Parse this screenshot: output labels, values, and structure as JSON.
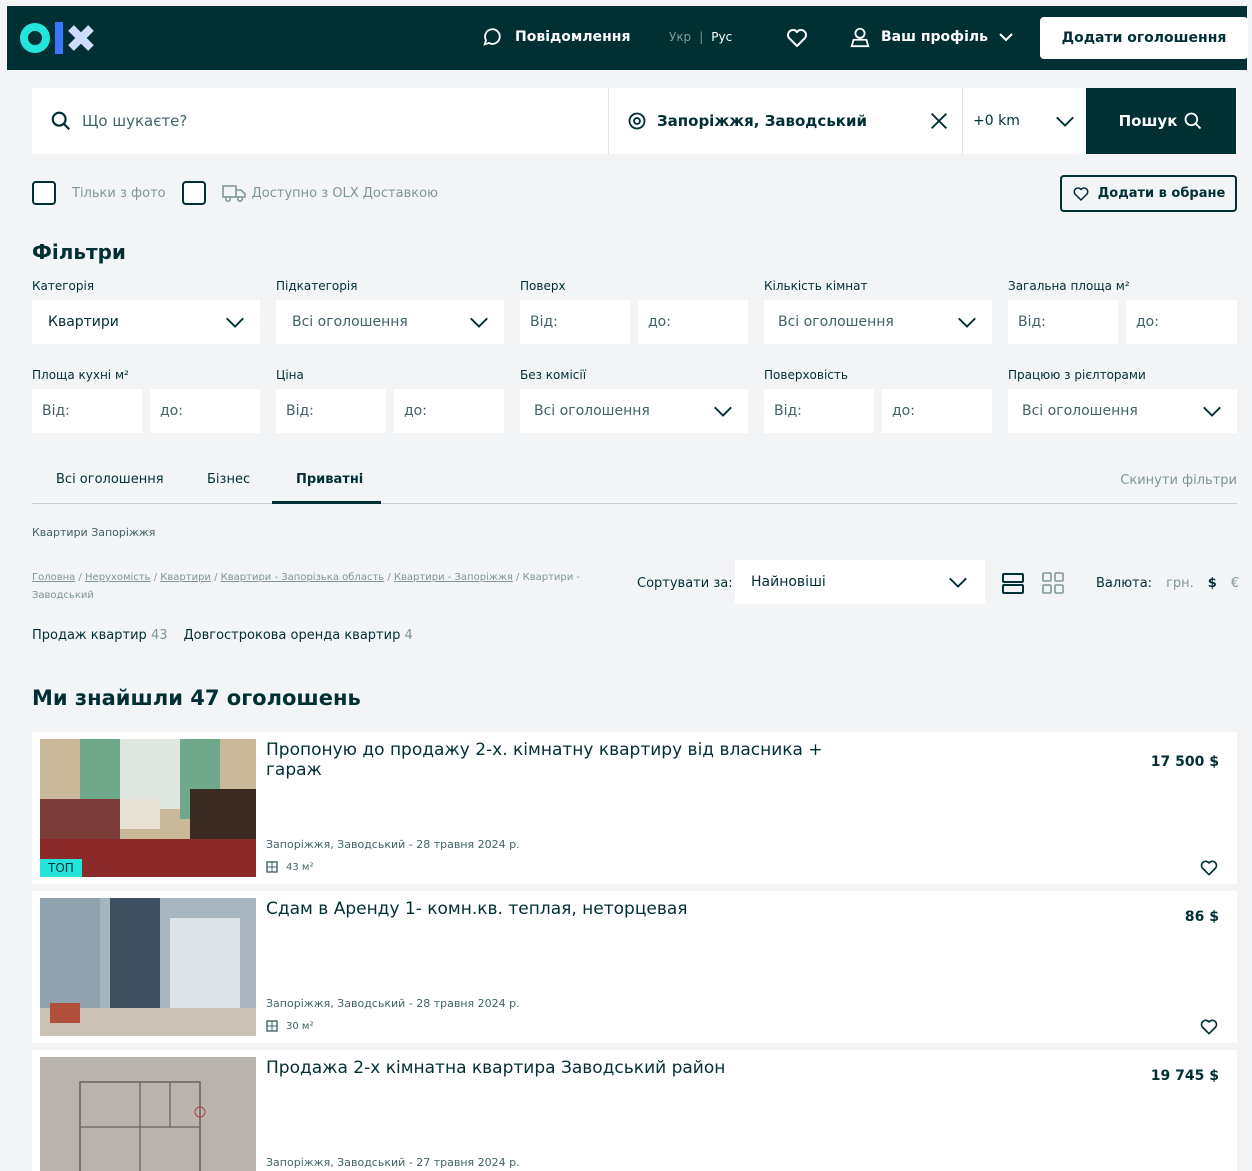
{
  "header": {
    "messages": "Повідомлення",
    "lang_uk": "Укр",
    "lang_ru": "Рус",
    "profile": "Ваш профіль",
    "add_listing": "Додати оголошення"
  },
  "search": {
    "placeholder": "Що шукаєте?",
    "location": "Запоріжжя, Заводський",
    "radius": "+0 km",
    "button": "Пошук"
  },
  "checks": {
    "photo_only": "Тільки з фото",
    "delivery": "Доступно з OLX Доставкою"
  },
  "favorites_button": "Додати в обране",
  "filters": {
    "title": "Фільтри",
    "category_label": "Категорія",
    "category_value": "Квартири",
    "subcategory_label": "Підкатегорія",
    "subcategory_value": "Всі оголошення",
    "floor_label": "Поверх",
    "rooms_label": "Кількість кімнат",
    "rooms_value": "Всі оголошення",
    "total_area_label": "Загальна площа м²",
    "kitchen_area_label": "Площа кухні м²",
    "price_label": "Ціна",
    "no_commission_label": "Без комісії",
    "no_commission_value": "Всі оголошення",
    "floors_label": "Поверховість",
    "realtors_label": "Працюю з рієлторами",
    "realtors_value": "Всі оголошення",
    "from": "Від:",
    "to": "до:"
  },
  "tabs": {
    "all": "Всі оголошення",
    "business": "Бізнес",
    "private": "Приватні",
    "reset": "Скинути фільтри"
  },
  "listing_heading": "Квартири Запоріжжя",
  "breadcrumb": {
    "home": "Головна",
    "realty": "Нерухомість",
    "apartments": "Квартири",
    "region": "Квартири - Запорізька область",
    "city": "Квартири - Запоріжжя",
    "current": "Квартири - Заводський"
  },
  "sort": {
    "label": "Сортувати за:",
    "value": "Найновіші"
  },
  "currency": {
    "label": "Валюта:",
    "uah": "грн.",
    "usd": "$",
    "eur": "€"
  },
  "subcats": [
    {
      "label": "Продаж квартир",
      "count": "43"
    },
    {
      "label": "Довгострокова оренда квартир",
      "count": "4"
    }
  ],
  "found_text": "Ми знайшли 47 оголошень",
  "cards": [
    {
      "title": "Пропоную до продажу 2-х. кімнатну квартиру від власника + гараж",
      "price": "17 500 $",
      "meta": "Запоріжжя, Заводський - 28 травня 2024 р.",
      "area": "43 м²",
      "badge": "ТОП"
    },
    {
      "title": "Сдам в Аренду 1- комн.кв. теплая, неторцевая",
      "price": "86 $",
      "meta": "Запоріжжя, Заводський - 28 травня 2024 р.",
      "area": "30 м²"
    },
    {
      "title": "Продажа 2-х кімнатна квартира Заводський район",
      "price": "19 745 $",
      "meta": "Запоріжжя, Заводський - 27 травня 2024 р."
    }
  ]
}
